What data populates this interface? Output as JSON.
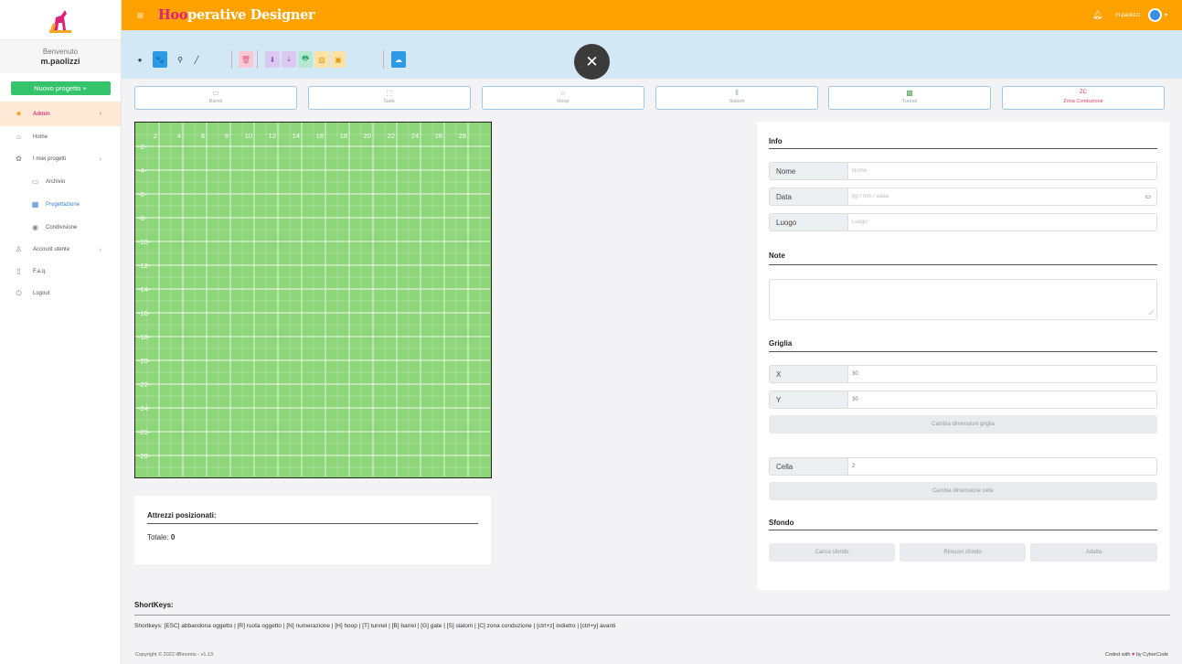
{
  "app": {
    "title_prefix": "H",
    "title_hoop": "oo",
    "title_mid": "perative",
    "title_suffix": " Designer",
    "username": "m.paolizzi"
  },
  "colors": {
    "topbar": "#ffa200",
    "brand_accent": "#e01f7a",
    "toolbar_bg": "#d3e8f5",
    "grid_green": "#8dd67a",
    "new_project": "#35c36b",
    "admin_bg": "#fde9d6"
  },
  "sidebar": {
    "welcome": "Benvenuto",
    "user": "m.paolizzi",
    "new_project": "Nuovo progetto +",
    "items": [
      {
        "label": "Admin",
        "icon": "circle-icon"
      },
      {
        "label": "Home",
        "icon": "home-icon"
      },
      {
        "label": "I miei progetti",
        "icon": "paw-icon"
      },
      {
        "label": "Archivio",
        "icon": "folder-icon"
      },
      {
        "label": "Progettazione",
        "icon": "table-icon"
      },
      {
        "label": "Condivisione",
        "icon": "share-icon"
      },
      {
        "label": "Account utente",
        "icon": "user-icon"
      },
      {
        "label": "F.a.q.",
        "icon": "book-icon"
      },
      {
        "label": "Logout",
        "icon": "power-icon"
      }
    ]
  },
  "toolbar": {
    "buttons": [
      {
        "icon": "dot-icon",
        "glyph": "●"
      },
      {
        "icon": "paw-icon",
        "glyph": "🐾"
      },
      {
        "icon": "numbering-icon",
        "glyph": "⚲"
      },
      {
        "icon": "line-icon",
        "glyph": "╱"
      },
      {
        "icon": "delete-icon",
        "glyph": "🗑"
      },
      {
        "icon": "download-icon",
        "glyph": "⬇"
      },
      {
        "icon": "download-file-icon",
        "glyph": "⤓"
      },
      {
        "icon": "print-icon",
        "glyph": "🖶"
      },
      {
        "icon": "image-icon",
        "glyph": "▨"
      },
      {
        "icon": "pdf-icon",
        "glyph": "▣"
      },
      {
        "icon": "cloud-icon",
        "glyph": "☁"
      }
    ]
  },
  "tools": [
    {
      "label": "Barrel",
      "icon": "barrel-icon",
      "glyph": "▭"
    },
    {
      "label": "Gate",
      "icon": "gate-icon",
      "glyph": "⬚"
    },
    {
      "label": "Hoop",
      "icon": "hoop-icon",
      "glyph": "∩"
    },
    {
      "label": "Slalom",
      "icon": "slalom-icon",
      "glyph": "⦀"
    },
    {
      "label": "Tunnel",
      "icon": "tunnel-icon",
      "glyph": "▩"
    },
    {
      "label": "Zona Conduzione",
      "icon": "zc-icon",
      "glyph": "ZC"
    }
  ],
  "grid": {
    "x_labels": [
      "2",
      "4",
      "6",
      "8",
      "10",
      "12",
      "14",
      "16",
      "18",
      "20",
      "22",
      "24",
      "26",
      "28"
    ],
    "y_labels": [
      "2",
      "4",
      "6",
      "8",
      "10",
      "12",
      "14",
      "16",
      "18",
      "20",
      "22",
      "24",
      "26",
      "28"
    ]
  },
  "equipment": {
    "title": "Attrezzi posizionati:",
    "total_label": "Totale:",
    "total_value": "0"
  },
  "info": {
    "title": "Info",
    "nome_label": "Nome",
    "nome_placeholder": "Nome",
    "data_label": "Data",
    "data_placeholder": "gg / mm / aaaa",
    "luogo_label": "Luogo",
    "luogo_placeholder": "Luogo"
  },
  "note": {
    "title": "Note"
  },
  "griglia": {
    "title": "Griglia",
    "x_label": "X",
    "x_value": "30",
    "y_label": "Y",
    "y_value": "30",
    "resize_grid": "Cambia dimensioni griglia",
    "cell_label": "Cella",
    "cell_value": "2",
    "resize_cells": "Cambia dimensione celle"
  },
  "sfondo": {
    "title": "Sfondo",
    "load": "Carica sfondo",
    "remove": "Rimuovi sfondo",
    "fit": "Adatta"
  },
  "shortkeys": {
    "title": "ShortKeys:",
    "text": "Shortkeys: [ESC] abbandona oggetto | [R] ruota oggetto | [N] numerazione | [H] hoop | [T] tunnel | [B] barrel | [G] gate | [S] slalom | [C] zona conduzione | [ctrl+z] indietro | [ctrl+y] avanti"
  },
  "footer": {
    "copyright": "Copyright © 2022 ilBinomio - v1.13",
    "coded_prefix": "Coded with",
    "coded_suffix": "by CyberCode"
  }
}
